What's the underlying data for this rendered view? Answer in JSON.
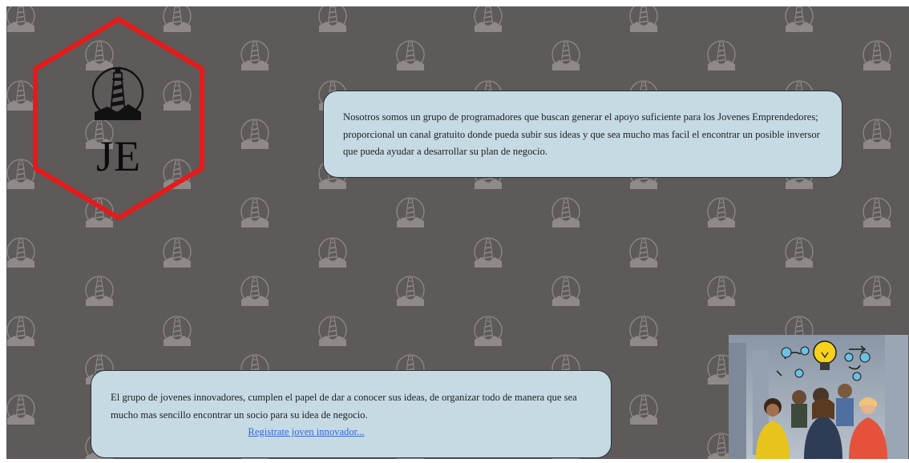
{
  "logo": {
    "brand": "JE",
    "hexagon_color": "#e61a1a",
    "icon": "lighthouse-icon"
  },
  "intro": {
    "text": "Nosotros somos un grupo de programadores que buscan generar el apoyo suficiente para los Jovenes Emprendedores; proporcional un canal gratuito donde pueda subir sus ideas y que sea mucho mas facil el encontrar un posible inversor que pueda ayudar a desarrollar su plan de negocio."
  },
  "group": {
    "text": "El grupo de jovenes innovadores, cumplen el papel de dar a conocer sus ideas, de organizar todo de manera que sea mucho mas sencillo encontrar un socio para su idea de negocio.",
    "link_label": "Registrate joven innovador..."
  },
  "colors": {
    "background": "#5e5a59",
    "card": "#c6dae4",
    "link": "#3366e0"
  },
  "photo": {
    "icon": "team-lightbulb-photo"
  }
}
